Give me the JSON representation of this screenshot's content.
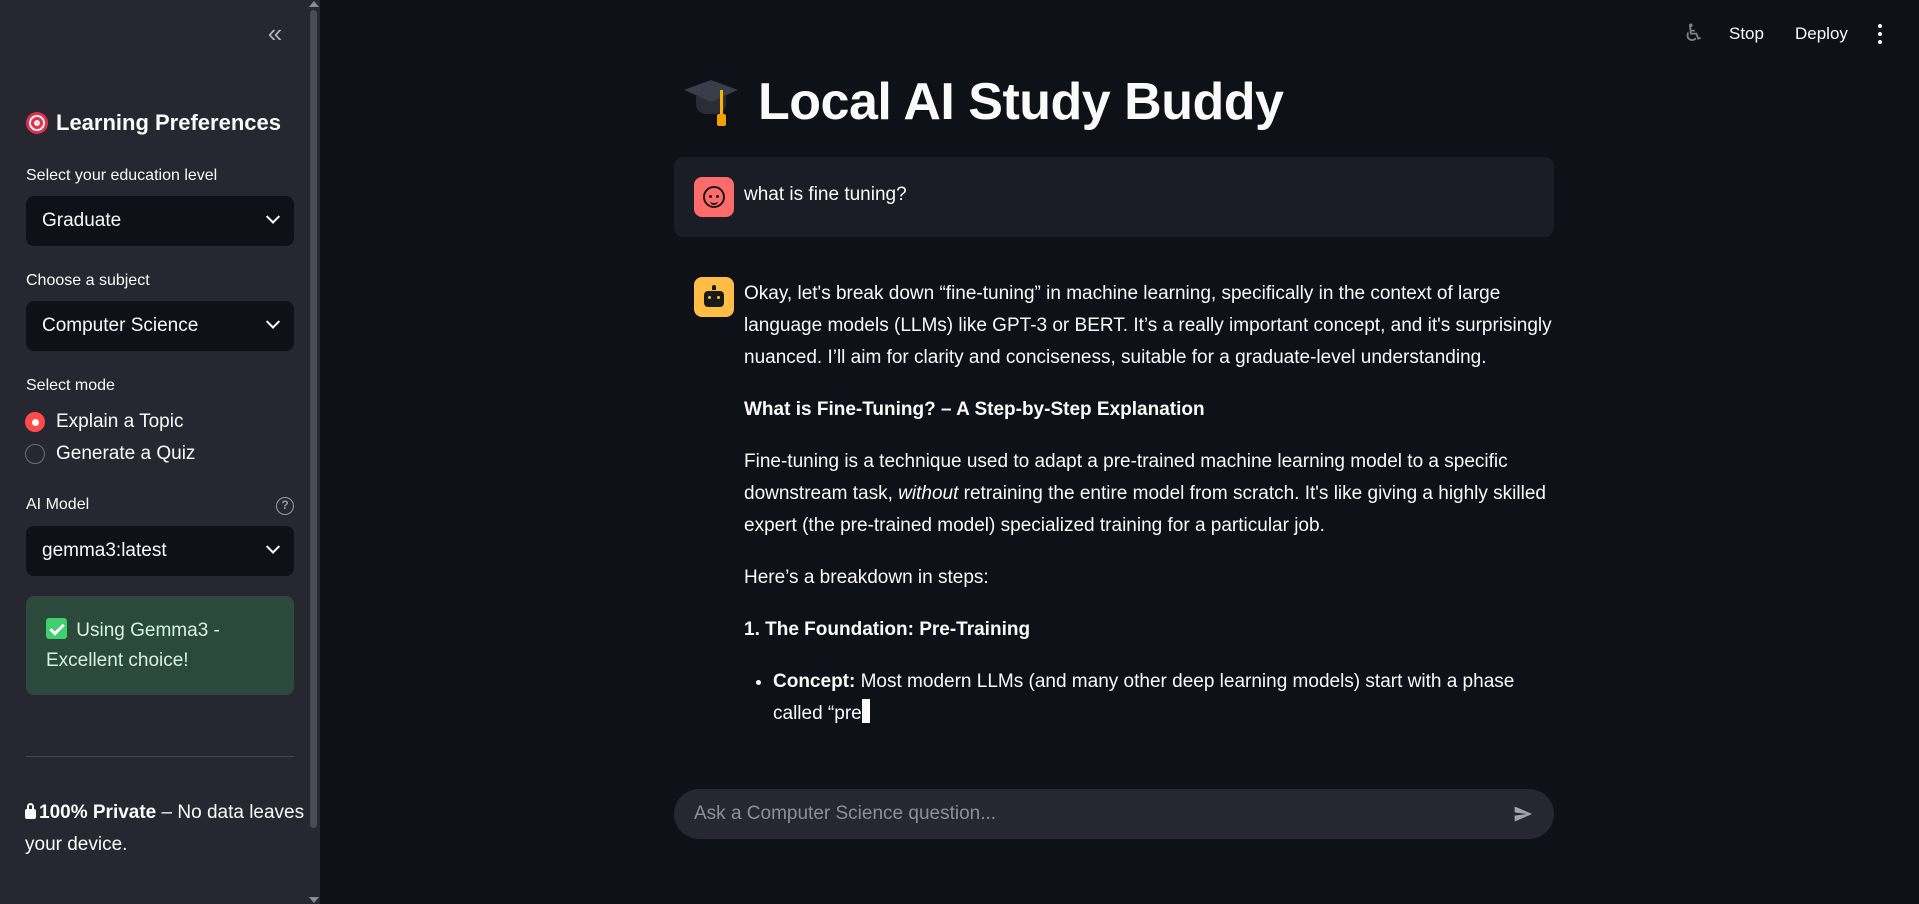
{
  "sidebar": {
    "title": "Learning Preferences",
    "education": {
      "label": "Select your education level",
      "value": "Graduate"
    },
    "subject": {
      "label": "Choose a subject",
      "value": "Computer Science"
    },
    "mode": {
      "label": "Select mode",
      "options": [
        "Explain a Topic",
        "Generate a Quiz"
      ],
      "selected": "Explain a Topic"
    },
    "model": {
      "label": "AI Model",
      "value": "gemma3:latest"
    },
    "status": "Using Gemma3 - Excellent choice!",
    "privacy_bold": "100% Private",
    "privacy_rest": " – No data leaves your device."
  },
  "topbar": {
    "stop": "Stop",
    "deploy": "Deploy"
  },
  "main": {
    "title": "Local AI Study Buddy",
    "user_message": "what is fine tuning?",
    "assistant": {
      "p1": "Okay, let's break down “fine-tuning” in machine learning, specifically in the context of large language models (LLMs) like GPT-3 or BERT. It’s a really important concept, and it's surprisingly nuanced. I’ll aim for clarity and conciseness, suitable for a graduate-level understanding.",
      "h1": "What is Fine-Tuning? – A Step-by-Step Explanation",
      "p2_a": "Fine-tuning is a technique used to adapt a pre-trained machine learning model to a specific downstream task, ",
      "p2_em": "without",
      "p2_b": " retraining the entire model from scratch. It's like giving a highly skilled expert (the pre-trained model) specialized training for a particular job.",
      "p3": "Here’s a breakdown in steps:",
      "h2": "1. The Foundation: Pre-Training",
      "bullet_label": "Concept:",
      "bullet_text": " Most modern LLMs (and many other deep learning models) start with a phase called “pre"
    },
    "chat_placeholder": "Ask a Computer Science question..."
  }
}
